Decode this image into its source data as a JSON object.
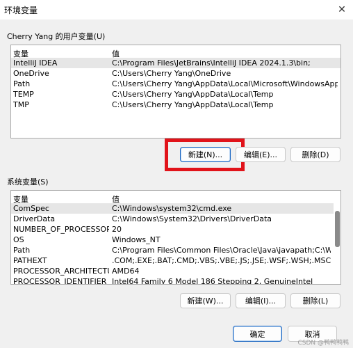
{
  "window": {
    "title": "环境变量",
    "close_glyph": "✕"
  },
  "user_vars": {
    "group_label": "Cherry Yang 的用户变量(U)",
    "header": {
      "variable": "变量",
      "value": "值"
    },
    "rows": [
      {
        "variable": "IntelliJ IDEA",
        "value": "C:\\Program Files\\JetBrains\\IntelliJ IDEA 2024.1.3\\bin;"
      },
      {
        "variable": "OneDrive",
        "value": "C:\\Users\\Cherry Yang\\OneDrive"
      },
      {
        "variable": "Path",
        "value": "C:\\Users\\Cherry Yang\\AppData\\Local\\Microsoft\\WindowsApps;..."
      },
      {
        "variable": "TEMP",
        "value": "C:\\Users\\Cherry Yang\\AppData\\Local\\Temp"
      },
      {
        "variable": "TMP",
        "value": "C:\\Users\\Cherry Yang\\AppData\\Local\\Temp"
      }
    ],
    "buttons": {
      "new": "新建(N)...",
      "edit": "编辑(E)...",
      "delete": "删除(D)"
    }
  },
  "system_vars": {
    "group_label": "系统变量(S)",
    "header": {
      "variable": "变量",
      "value": "值"
    },
    "rows": [
      {
        "variable": "ComSpec",
        "value": "C:\\Windows\\system32\\cmd.exe"
      },
      {
        "variable": "DriverData",
        "value": "C:\\Windows\\System32\\Drivers\\DriverData"
      },
      {
        "variable": "NUMBER_OF_PROCESSORS",
        "value": "20"
      },
      {
        "variable": "OS",
        "value": "Windows_NT"
      },
      {
        "variable": "Path",
        "value": "C:\\Program Files\\Common Files\\Oracle\\Java\\javapath;C:\\Windo..."
      },
      {
        "variable": "PATHEXT",
        "value": ".COM;.EXE;.BAT;.CMD;.VBS;.VBE;.JS;.JSE;.WSF;.WSH;.MSC"
      },
      {
        "variable": "PROCESSOR_ARCHITECTU...",
        "value": "AMD64"
      },
      {
        "variable": "PROCESSOR_IDENTIFIER",
        "value": "Intel64 Family 6 Model 186 Stepping 2, GenuineIntel"
      }
    ],
    "buttons": {
      "new": "新建(W)...",
      "edit": "编辑(I)...",
      "delete": "删除(L)"
    }
  },
  "footer": {
    "ok": "确定",
    "cancel": "取消"
  },
  "watermark": "CSDN @鸭鸭鸭鸭",
  "colors": {
    "highlight": "#e1131a",
    "accent": "#1a66c2"
  }
}
